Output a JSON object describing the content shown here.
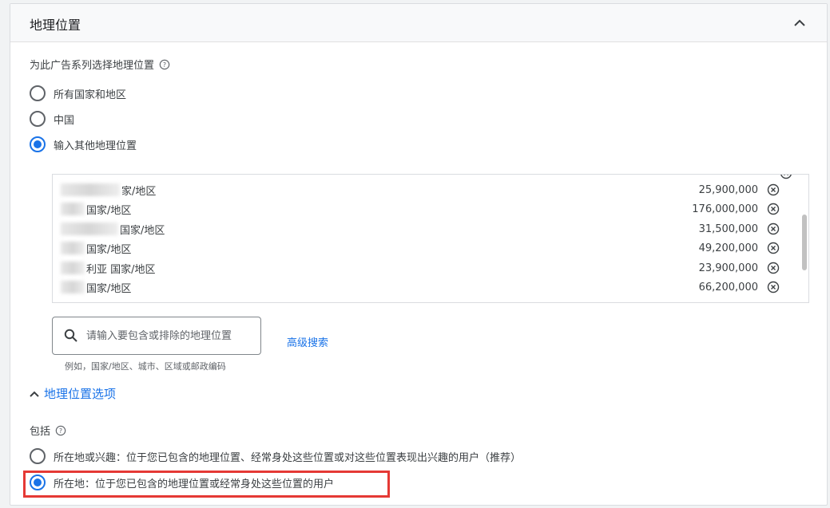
{
  "header": {
    "title": "地理位置"
  },
  "target": {
    "label": "为此广告系列选择地理位置",
    "options": [
      {
        "label": "所有国家和地区",
        "checked": false
      },
      {
        "label": "中国",
        "checked": false
      },
      {
        "label": "输入其他地理位置",
        "checked": true
      }
    ]
  },
  "locations": [
    {
      "name_suffix": "家/地区",
      "reach": "25,900,000"
    },
    {
      "name_suffix": "国家/地区",
      "reach": "176,000,000"
    },
    {
      "name_suffix": "国家/地区",
      "reach": "31,500,000"
    },
    {
      "name_suffix": "国家/地区",
      "reach": "49,200,000"
    },
    {
      "name_suffix": "利亚 国家/地区",
      "reach": "23,900,000"
    },
    {
      "name_suffix": "国家/地区",
      "reach": "66,200,000"
    }
  ],
  "search": {
    "placeholder": "请输入要包含或排除的地理位置",
    "hint": "例如，国家/地区、城市、区域或邮政编码",
    "advanced_link": "高级搜索"
  },
  "location_options": {
    "toggle_label": "地理位置选项",
    "include_label": "包括",
    "include_options": [
      {
        "label": "所在地或兴趣：位于您已包含的地理位置、经常身处这些位置或对这些位置表现出兴趣的用户（推荐）",
        "checked": false
      },
      {
        "label": "所在地：位于您已包含的地理位置或经常身处这些位置的用户",
        "checked": true
      }
    ]
  },
  "colors": {
    "accent": "#1a73e8",
    "highlight": "#e53935"
  }
}
